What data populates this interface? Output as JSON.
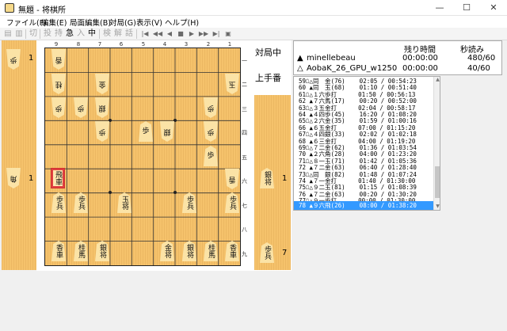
{
  "window": {
    "title": "無題 - 将棋所",
    "minimize": "—",
    "maximize": "☐",
    "close": "✕"
  },
  "menu": [
    "ファイル(F)",
    "編集(E)",
    "局面編集(B)",
    "対局(G)",
    "表示(V)",
    "ヘルプ(H)"
  ],
  "toolbar": {
    "items": [
      "切",
      "投",
      "持",
      "急",
      "入",
      "中",
      "検",
      "解",
      "話"
    ],
    "nav": [
      "|◀",
      "◀◀",
      "◀",
      "■",
      "▶",
      "▶▶",
      "▶|",
      "▣"
    ]
  },
  "board": {
    "file_labels": [
      "9",
      "8",
      "7",
      "6",
      "5",
      "4",
      "3",
      "2",
      "1"
    ],
    "rank_labels": [
      "一",
      "二",
      "三",
      "四",
      "五",
      "六",
      "七",
      "八",
      "九"
    ],
    "gote_pieces": [
      {
        "text": "香"
      },
      {
        "text": "桂"
      },
      {
        "text": "金"
      },
      {
        "text": "玉"
      },
      {
        "text": "香"
      },
      {
        "text": "歩"
      },
      {
        "text": "歩"
      },
      {
        "text": "銀"
      },
      {
        "text": "歩"
      },
      {
        "text": "歩"
      },
      {
        "text": "銀"
      },
      {
        "text": "歩"
      }
    ],
    "sente_pieces": [
      {
        "text": "歩"
      },
      {
        "text": "歩"
      },
      {
        "text": "飛車"
      },
      {
        "text": "歩兵"
      },
      {
        "text": "歩兵"
      },
      {
        "text": "玉将"
      },
      {
        "text": "歩兵"
      },
      {
        "text": "歩兵"
      },
      {
        "text": "香車"
      },
      {
        "text": "桂馬"
      },
      {
        "text": "銀将"
      },
      {
        "text": "金将"
      },
      {
        "text": "銀将"
      },
      {
        "text": "桂馬"
      },
      {
        "text": "香車"
      }
    ]
  },
  "hands": {
    "gote_left": [
      {
        "piece": "歩",
        "count": "1"
      },
      {
        "piece": "角",
        "count": "1"
      }
    ],
    "sente_right": [
      {
        "piece": "銀将",
        "count": "1"
      },
      {
        "piece": "歩兵",
        "count": "7"
      }
    ]
  },
  "status": {
    "game": "対局中",
    "turn": "上手番"
  },
  "players": {
    "header_remain": "残り時間",
    "header_byoyomi": "秒読み",
    "rows": [
      {
        "mark": "▲",
        "name": "minellebeau",
        "time": "00:00:00",
        "byoyomi": "480/60"
      },
      {
        "mark": "△",
        "name": "AobaK_26_GPU_w1250",
        "time": "00:00:00",
        "byoyomi": "40/60"
      }
    ]
  },
  "moves": [
    "59☖△同　金(76)    02:05 / 00:54:23",
    "60 ▲同　玉(68)    01:10 / 00:51:40",
    "61☖△１六歩打      01:50 / 00:56:13",
    "62 ▲７六馬(17)    00:20 / 00:52:00",
    "63☖△３五金打      02:04 / 00:58:17",
    "64 ▲４四歩(45)    16:20 / 01:08:20",
    "65☖△２六金(35)    01:59 / 01:00:16",
    "66 ▲６五金打      07:00 / 01:15:20",
    "67☖△４四銀(33)    02:02 / 01:02:18",
    "68 ▲６三金打      04:00 / 01:19:20",
    "69☖△７二金(62)    01:36 / 01:03:54",
    "70 ▲２六角(28)    04:00 / 01:23:20",
    "71☖△８一玉(71)    01:42 / 01:05:36",
    "72 ▲７二金(63)    06:40 / 01:28:40",
    "73☖△同　銀(82)    01:48 / 01:07:24",
    "74 ▲７一金打      01:40 / 01:30:00",
    "75☖△９二玉(81)    01:15 / 01:08:39",
    "76 ▲７二金(63)    00:20 / 01:30:20",
    "77☖△９一歩打      00:00 / 01:30:00",
    "78 ▲９六飛(26)    08:00 / 01:38:20"
  ]
}
